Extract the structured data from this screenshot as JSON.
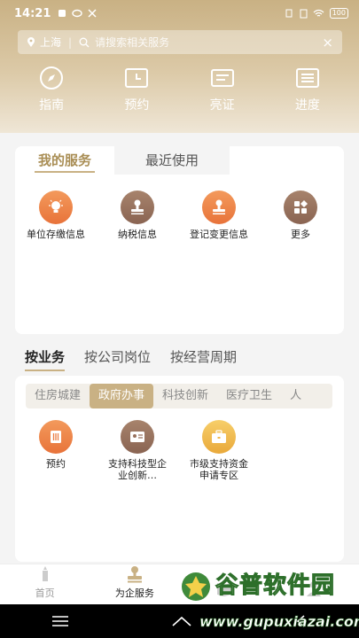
{
  "status_bar": {
    "time": "14:21",
    "battery": "100"
  },
  "search": {
    "city": "上海",
    "placeholder": "请搜索相关服务",
    "clear": "×"
  },
  "quick_actions": [
    {
      "label": "指南",
      "icon": "compass-icon"
    },
    {
      "label": "预约",
      "icon": "calendar-icon"
    },
    {
      "label": "亮证",
      "icon": "id-card-icon"
    },
    {
      "label": "进度",
      "icon": "progress-list-icon"
    }
  ],
  "my_services": {
    "tabs": [
      {
        "label": "我的服务"
      },
      {
        "label": "最近使用"
      }
    ],
    "items": [
      {
        "label": "单位存缴信息",
        "icon": "lightbulb-icon",
        "color": "#ec7e45"
      },
      {
        "label": "纳税信息",
        "icon": "stamp-icon",
        "color": "#98715d"
      },
      {
        "label": "登记变更信息",
        "icon": "stamp-icon",
        "color": "#ec7e45"
      },
      {
        "label": "更多",
        "icon": "grid-more-icon",
        "color": "#98715d"
      }
    ]
  },
  "category_tabs": [
    {
      "label": "按业务"
    },
    {
      "label": "按公司岗位"
    },
    {
      "label": "按经营周期"
    }
  ],
  "business_categories": [
    {
      "label": "住房城建"
    },
    {
      "label": "政府办事"
    },
    {
      "label": "科技创新"
    },
    {
      "label": "医疗卫生"
    },
    {
      "label": "人"
    }
  ],
  "business_items": [
    {
      "label": "预约",
      "icon": "document-icon",
      "color": "#ec7e45"
    },
    {
      "label": "支持科技型企业创新…",
      "icon": "id-card-icon",
      "color": "#98715d"
    },
    {
      "label": "市级支持资金申请专区",
      "icon": "briefcase-icon",
      "color": "#f0b94c"
    }
  ],
  "bottom_nav": [
    {
      "label": "首页",
      "icon": "home-icon"
    },
    {
      "label": "为企服务",
      "icon": "enterprise-icon"
    },
    {
      "label": "",
      "icon": "book-icon"
    },
    {
      "label": "",
      "icon": "person-icon"
    }
  ],
  "watermark": {
    "title": "谷普软件园",
    "url": "www.gupuxiazai.com"
  },
  "colors": {
    "brand": "#c9b184",
    "accent_text": "#a98e55",
    "orange": "#ec7e45",
    "brown": "#98715d",
    "gold": "#f0b94c"
  }
}
